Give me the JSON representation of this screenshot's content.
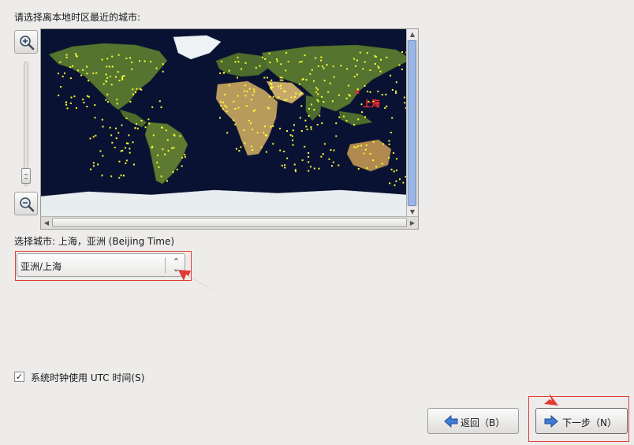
{
  "prompt": "请选择离本地时区最近的城市:",
  "map": {
    "marker_label": "上海",
    "marker_symbol": "x",
    "zoom_in_icon": "zoom-in-icon",
    "zoom_out_icon": "zoom-out-icon",
    "ocean_color": "#0a1233",
    "city_dot_color": "#ffff33",
    "marker_color": "#ff2a2a"
  },
  "selected_city_label": "选择城市: 上海，亚洲 (Beijing Time)",
  "timezone_combo": {
    "value": "亚洲/上海"
  },
  "utc_checkbox": {
    "label": "系统时钟使用 UTC 时间(S)",
    "checked": true,
    "check_glyph": "✓"
  },
  "buttons": {
    "back": {
      "label": "返回（B）",
      "icon": "arrow-left-icon"
    },
    "next": {
      "label": "下一步（N）",
      "icon": "arrow-right-icon"
    }
  },
  "annotation_color": "#e23b36"
}
